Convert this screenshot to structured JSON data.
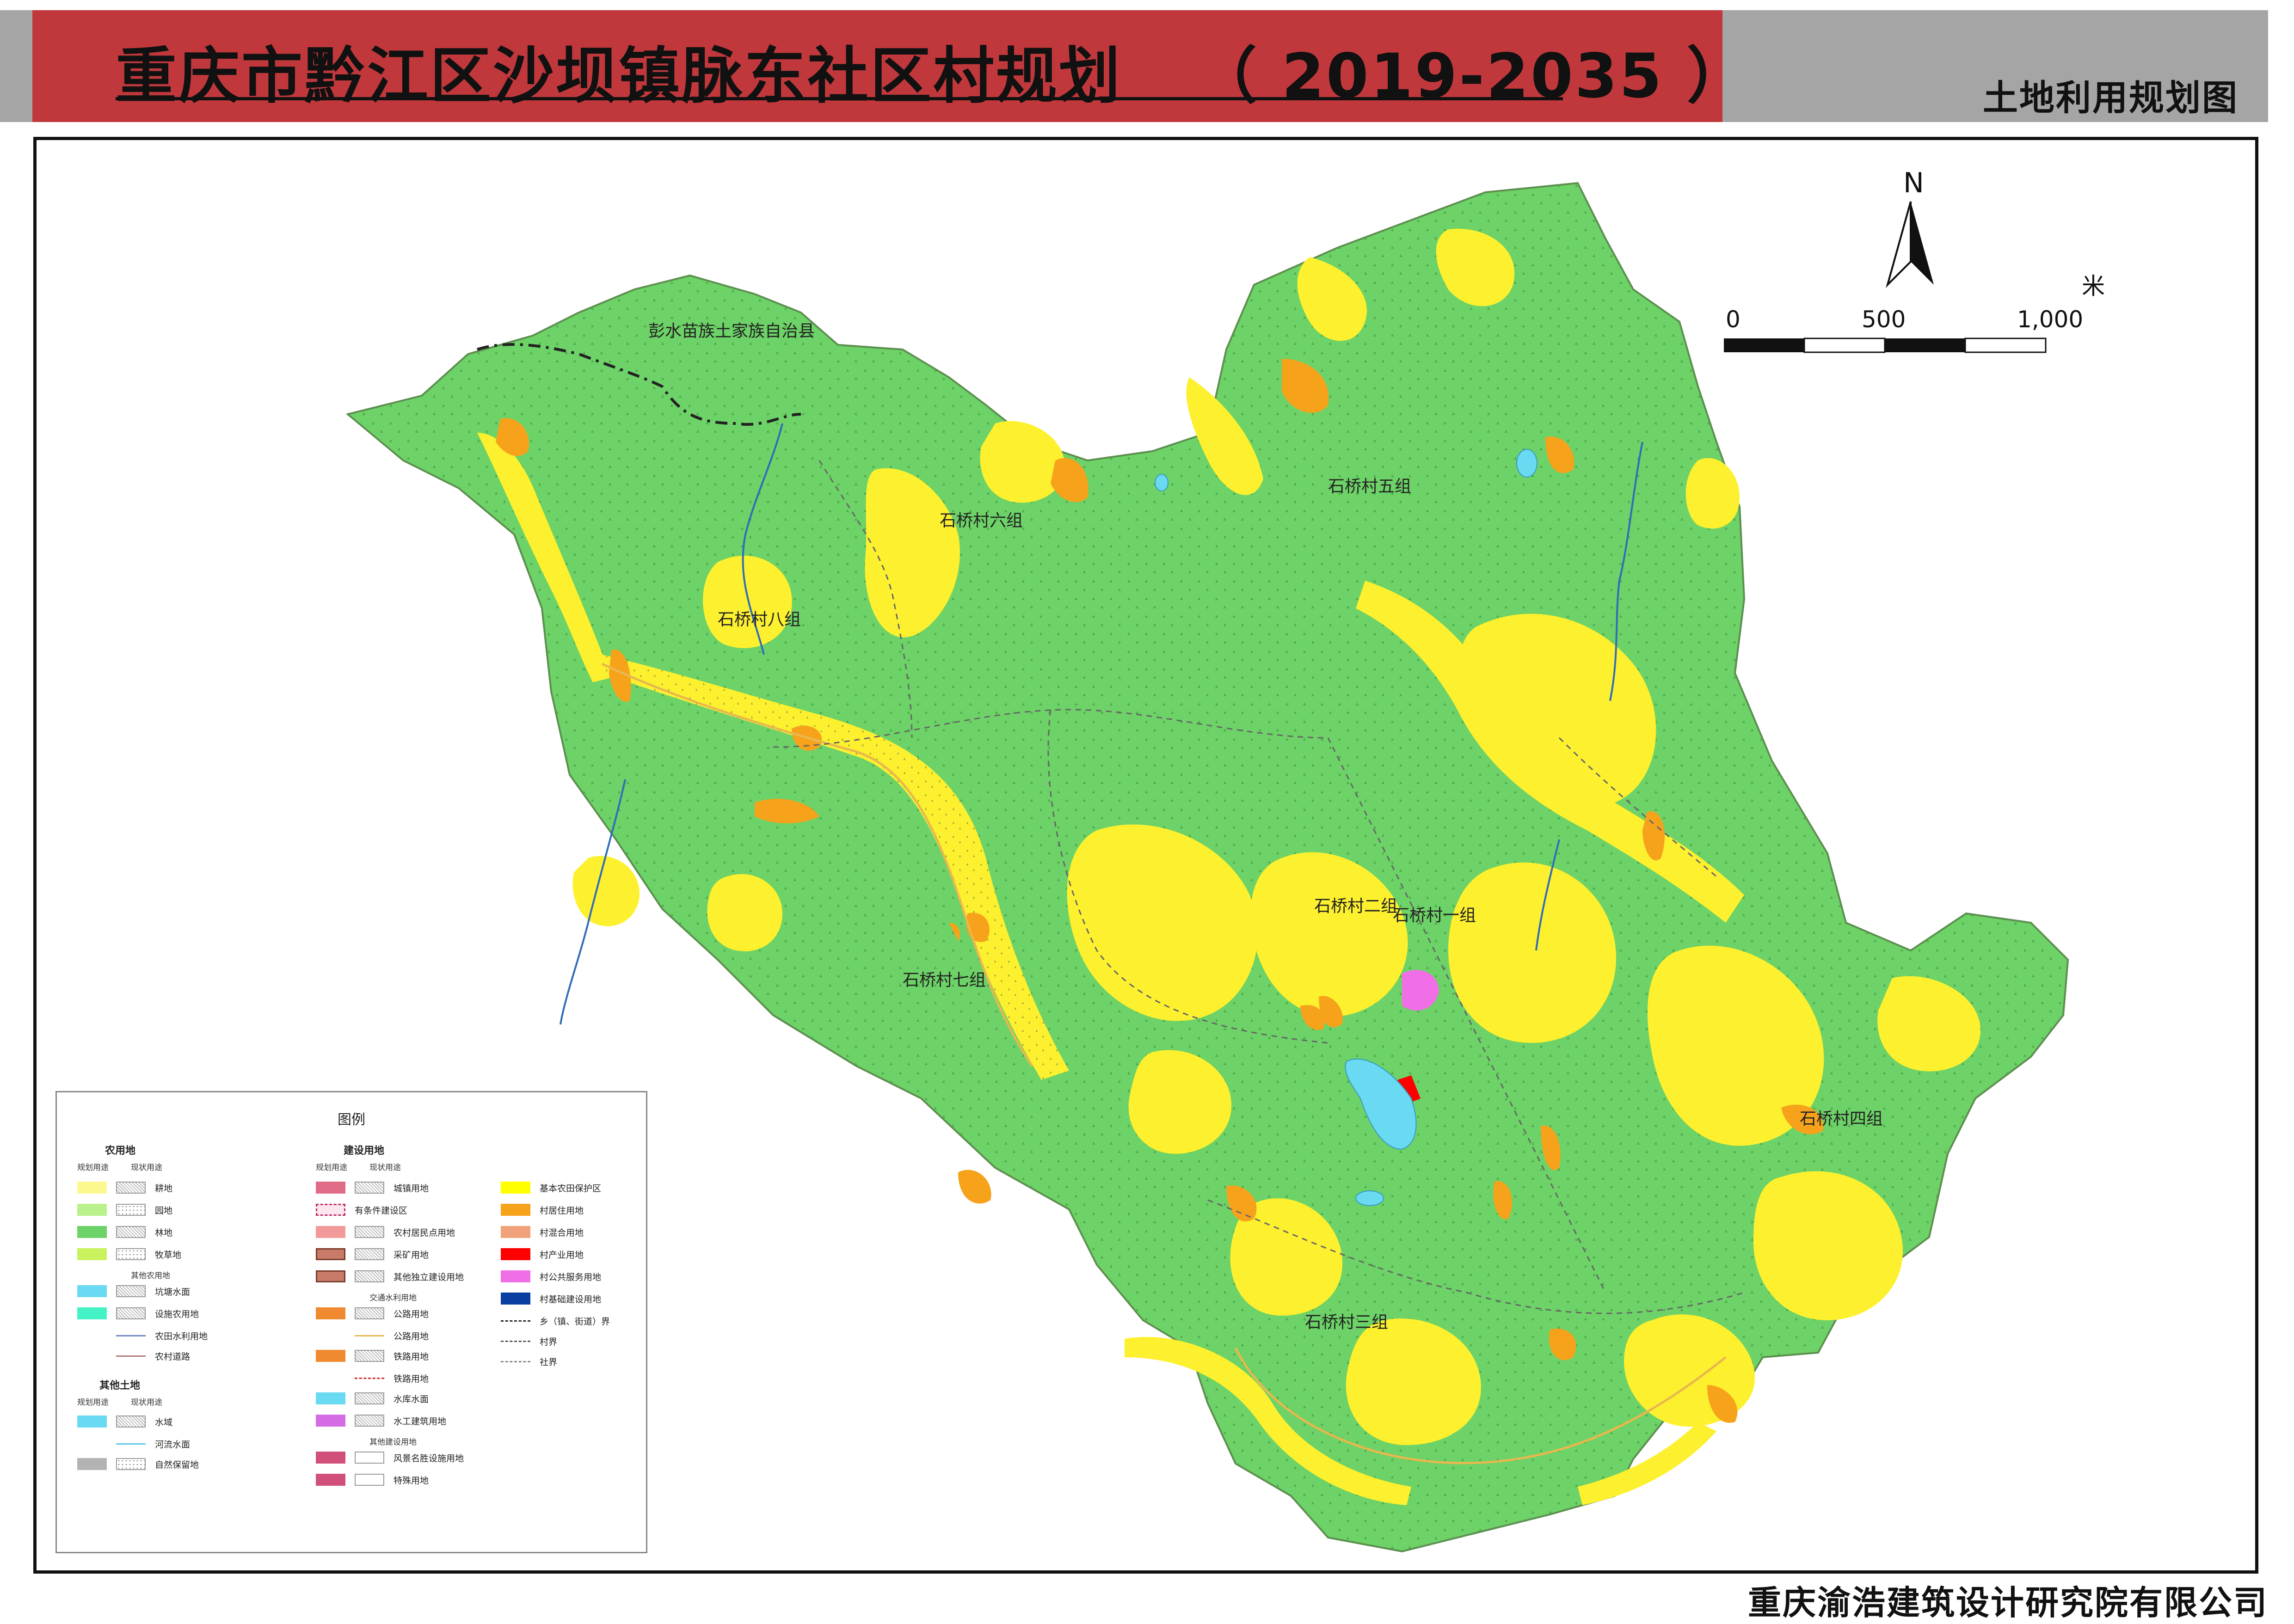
{
  "header": {
    "title": "重庆市黔江区沙坝镇脉东社区村规划",
    "years": "（ 2019-2035 ）",
    "map_type": "土地利用规划图"
  },
  "map": {
    "north_label": "N",
    "scale_unit": "米",
    "scale_ticks": [
      "0",
      "500",
      "1,000"
    ],
    "place_labels": {
      "county": "彭水苗族土家族自治县",
      "g1": "石桥村一组",
      "g2": "石桥村二组",
      "g3": "石桥村三组",
      "g4": "石桥村四组",
      "g5": "石桥村五组",
      "g6": "石桥村六组",
      "g7": "石桥村七组",
      "g8": "石桥村八组"
    },
    "colors": {
      "forest": "#6dd267",
      "farmland": "#fdf02e",
      "basic_farmland": "#ffff00",
      "village_residential": "#f7a21b",
      "public_service": "#f06fe6",
      "industry": "#ff0000",
      "water": "#6ad9f2",
      "river": "#2f6db8"
    }
  },
  "legend": {
    "title": "图例",
    "agri": {
      "head": "农用地",
      "planned": "规划用途",
      "current": "现状用途",
      "items": [
        "耕地",
        "园地",
        "林地",
        "牧草地"
      ],
      "other_head": "其他农用地",
      "other_items": [
        "坑塘水面",
        "设施农用地",
        "农田水利用地",
        "农村道路"
      ]
    },
    "other_land": {
      "head": "其他土地",
      "planned": "规划用途",
      "current": "现状用途",
      "items": [
        "水域",
        "河流水面",
        "自然保留地"
      ]
    },
    "construction": {
      "head": "建设用地",
      "planned": "规划用途",
      "current": "现状用途",
      "items": [
        "城镇用地",
        "有条件建设区",
        "农村居民点用地",
        "采矿用地",
        "其他独立建设用地"
      ],
      "traffic_head": "交通水利用地",
      "traffic_items": [
        "公路用地",
        "公路用地",
        "铁路用地",
        "铁路用地",
        "水库水面",
        "水工建筑用地"
      ],
      "other_build_head": "其他建设用地",
      "other_build_items": [
        "风景名胜设施用地",
        "特殊用地"
      ]
    },
    "right": {
      "items": [
        "基本农田保护区",
        "村居住用地",
        "村混合用地",
        "村产业用地",
        "村公共服务用地",
        "村基础建设用地"
      ],
      "boundaries": [
        "乡（镇、街道）界",
        "村界",
        "社界"
      ]
    }
  },
  "company": "重庆渝浩建筑设计研究院有限公司"
}
